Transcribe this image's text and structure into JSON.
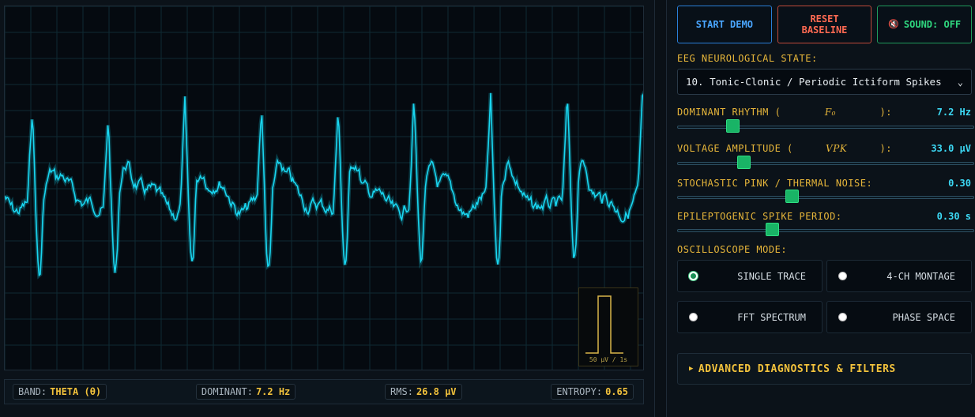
{
  "controls": {
    "start_label": "START DEMO",
    "reset_label": "RESET BASELINE",
    "sound_icon": "speaker-muted-icon",
    "sound_icon_glyph": "🔇",
    "sound_label": "SOUND: OFF"
  },
  "state": {
    "label": "EEG NEUROLOGICAL STATE:",
    "selected": "10. Tonic-Clonic / Periodic Ictiform Spikes",
    "chevron": "⌄"
  },
  "sliders": [
    {
      "label_pre": "DOMINANT RHYTHM (",
      "symbol": "F₀",
      "label_post": "):",
      "value_text": "7.2 Hz",
      "level": 0.17
    },
    {
      "label_pre": "VOLTAGE AMPLITUDE (",
      "symbol": "VPK",
      "label_post": "):",
      "value_text": "33.0 µV",
      "level": 0.21
    },
    {
      "label_pre": "STOCHASTIC PINK / THERMAL NOISE:",
      "symbol": "",
      "label_post": "",
      "value_text": "0.30",
      "level": 0.38
    },
    {
      "label_pre": "EPILEPTOGENIC SPIKE PERIOD:",
      "symbol": "",
      "label_post": "",
      "value_text": "0.30 s",
      "level": 0.31
    }
  ],
  "modes": {
    "label": "OSCILLOSCOPE MODE:",
    "options": [
      {
        "label": "SINGLE TRACE",
        "selected": true
      },
      {
        "label": "4-CH MONTAGE",
        "selected": false
      },
      {
        "label": "FFT SPECTRUM",
        "selected": false
      },
      {
        "label": "PHASE SPACE",
        "selected": false
      }
    ]
  },
  "advanced": {
    "label": "ADVANCED DIAGNOSTICS & FILTERS",
    "icon": "triangle-right-icon"
  },
  "scope": {
    "calibration_label": "50 µV / 1s",
    "trace_color": "#19d6f0",
    "grid_color": "#0f2a33"
  },
  "status": {
    "band_label": "BAND:",
    "band_value": "THETA (θ)",
    "dominant_label": "DOMINANT:",
    "dominant_value": "7.2 Hz",
    "rms_label": "RMS:",
    "rms_value": "26.8 µV",
    "entropy_label": "ENTROPY:",
    "entropy_value": "0.65"
  },
  "colors": {
    "accent": "#3cd8f4",
    "label": "#e7b63a",
    "thumb": "#19b466"
  }
}
